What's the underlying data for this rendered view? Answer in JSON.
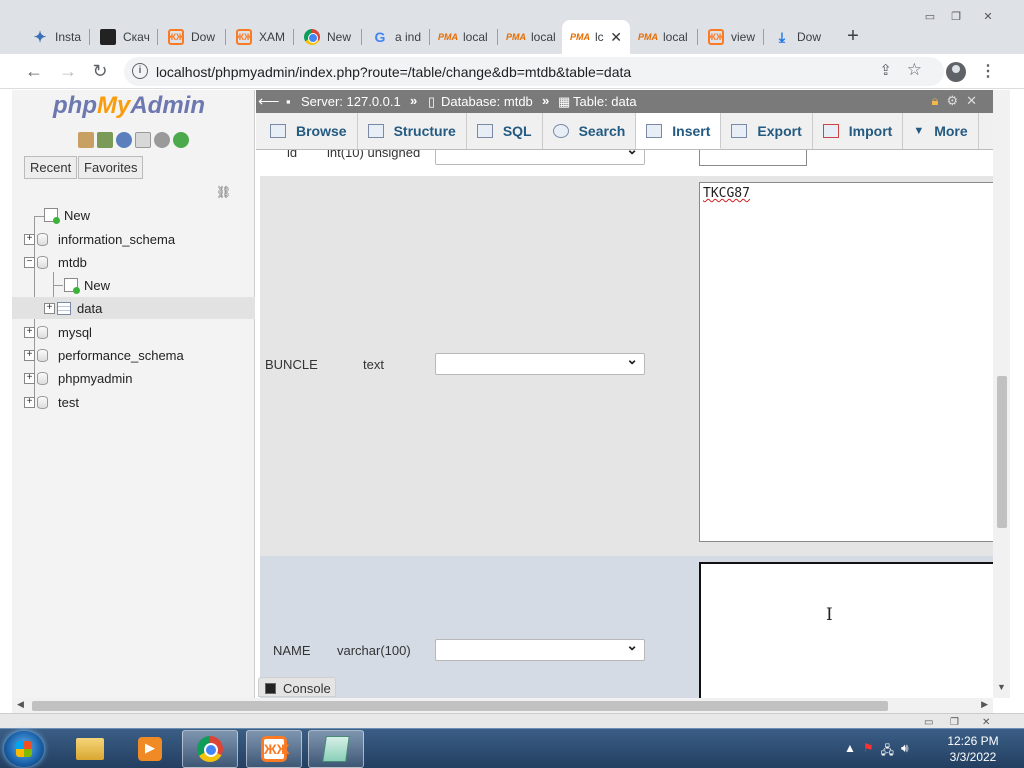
{
  "browser": {
    "tabs": [
      {
        "title": "Insta",
        "icon": "instaddr-icon"
      },
      {
        "title": "Скач",
        "icon": "terminal-icon"
      },
      {
        "title": "Dow",
        "icon": "xampp-icon"
      },
      {
        "title": "XAM",
        "icon": "xampp-icon"
      },
      {
        "title": "New",
        "icon": "chrome-icon"
      },
      {
        "title": "a ind",
        "icon": "google-icon"
      },
      {
        "title": "local",
        "icon": "phpmyadmin-icon"
      },
      {
        "title": "local",
        "icon": "phpmyadmin-icon"
      },
      {
        "title": "lc",
        "icon": "phpmyadmin-icon",
        "active": true
      },
      {
        "title": "local",
        "icon": "phpmyadmin-icon"
      },
      {
        "title": "view",
        "icon": "xampp-icon"
      },
      {
        "title": "Dow",
        "icon": "download-icon"
      }
    ],
    "close_glyph": "✕",
    "new_tab_glyph": "+",
    "url": "localhost/phpmyadmin/index.php?route=/table/change&db=mtdb&table=data"
  },
  "sidebar": {
    "logo": {
      "php": "php",
      "my": "My",
      "admin": "Admin"
    },
    "tabs": [
      "Recent",
      "Favorites"
    ],
    "tree": {
      "new_root": "New",
      "databases": [
        "information_schema",
        "mtdb",
        "mysql",
        "performance_schema",
        "phpmyadmin",
        "test"
      ],
      "mtdb_new": "New",
      "mtdb_table": "data"
    }
  },
  "breadcrumb": {
    "server": "Server: 127.0.0.1",
    "database": "Database: mtdb",
    "table": "Table: data",
    "sep": "»"
  },
  "menu": {
    "tabs": [
      "Browse",
      "Structure",
      "SQL",
      "Search",
      "Insert",
      "Export",
      "Import",
      "More"
    ],
    "active": "Insert"
  },
  "form": {
    "rows": [
      {
        "name": "id",
        "type": "int(10) unsigned",
        "value": ""
      },
      {
        "name": "BUNCLE",
        "type": "text",
        "value": "TKCG87"
      },
      {
        "name": "NAME",
        "type": "varchar(100)",
        "value": ""
      }
    ]
  },
  "console": {
    "label": "Console"
  },
  "taskbar": {
    "clock_time": "12:26 PM",
    "clock_date": "3/3/2022"
  }
}
